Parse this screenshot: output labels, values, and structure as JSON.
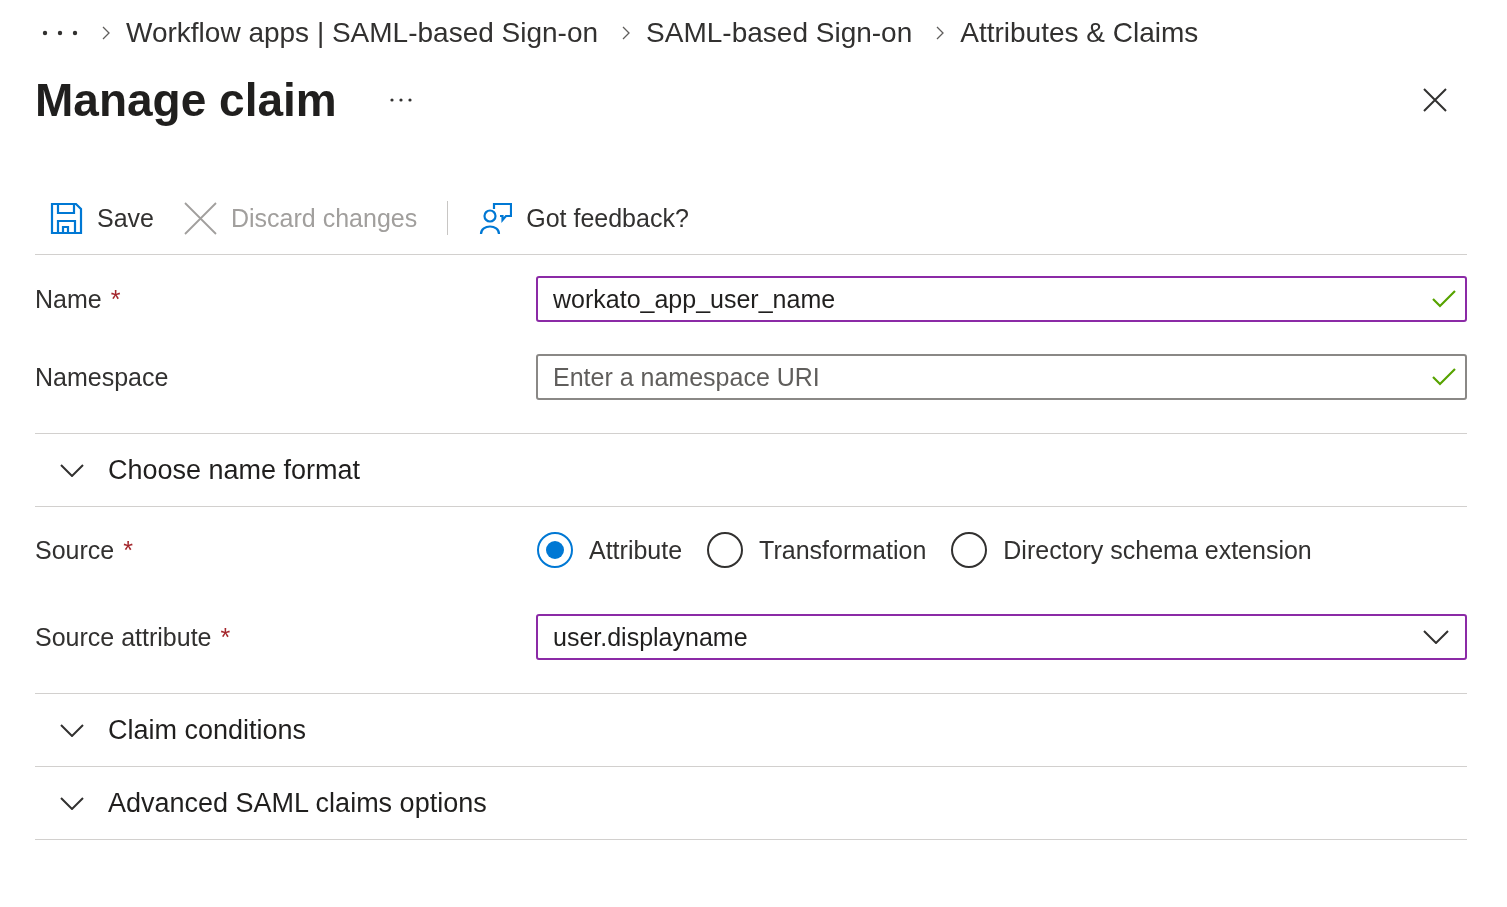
{
  "breadcrumb": [
    "Workflow apps | SAML-based Sign-on",
    "SAML-based Sign-on",
    "Attributes & Claims"
  ],
  "title": "Manage claim",
  "toolbar": {
    "groups": [
      {
        "buttons": [
          {
            "kind": "save",
            "label": "Save",
            "disabled": false
          },
          {
            "kind": "discard",
            "label": "Discard changes",
            "disabled": true
          }
        ]
      },
      {
        "buttons": [
          {
            "kind": "feedback",
            "label": "Got feedback?",
            "disabled": false
          }
        ]
      }
    ]
  },
  "rows": [
    {
      "kind": "text",
      "label": "Name",
      "required_marker": "*",
      "value": "workato_app_user_name",
      "active": true,
      "valid": true
    },
    {
      "kind": "text",
      "label": "Namespace",
      "placeholder": "Enter a namespace URI",
      "active": false,
      "valid": true
    },
    {
      "kind": "section",
      "label": "Choose name format",
      "expanded": false
    },
    {
      "kind": "radio",
      "label": "Source",
      "required_marker": "*",
      "options": [
        {
          "label": "Attribute",
          "selected": true
        },
        {
          "label": "Transformation",
          "selected": false
        },
        {
          "label": "Directory schema extension",
          "selected": false
        }
      ]
    },
    {
      "kind": "dropdown",
      "label": "Source attribute",
      "required_marker": "*",
      "value": "user.displayname",
      "active": true
    },
    {
      "kind": "section",
      "label": "Claim conditions",
      "expanded": false
    },
    {
      "kind": "section",
      "label": "Advanced SAML claims options",
      "expanded": false
    }
  ]
}
